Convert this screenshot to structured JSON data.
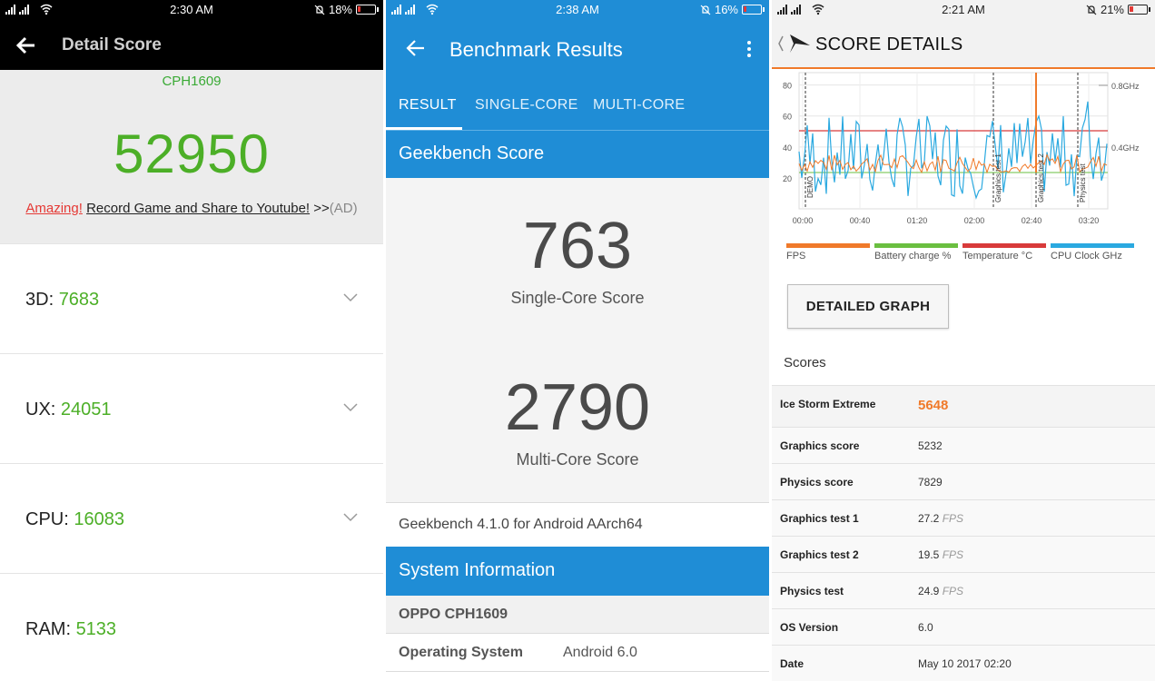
{
  "panel1": {
    "status": {
      "time": "2:30 AM",
      "battery": "18%",
      "battery_level": 0.18
    },
    "title": "Detail Score",
    "model": "CPH1609",
    "total_score": "52950",
    "promo": {
      "amazing": "Amazing!",
      "text": "Record Game and Share to Youtube!",
      "arrows": ">>",
      "ad": "(AD)"
    },
    "rows": [
      {
        "label": "3D:",
        "value": "7683"
      },
      {
        "label": "UX:",
        "value": "24051"
      },
      {
        "label": "CPU:",
        "value": "16083"
      },
      {
        "label": "RAM:",
        "value": "5133"
      }
    ]
  },
  "panel2": {
    "status": {
      "time": "2:38 AM",
      "battery": "16%",
      "battery_level": 0.16
    },
    "title": "Benchmark Results",
    "tabs": [
      "RESULT",
      "SINGLE-CORE",
      "MULTI-CORE"
    ],
    "score_header": "Geekbench Score",
    "single_core": {
      "value": "763",
      "label": "Single-Core Score"
    },
    "multi_core": {
      "value": "2790",
      "label": "Multi-Core Score"
    },
    "version": "Geekbench 4.1.0 for Android AArch64",
    "sys_header": "System Information",
    "device": "OPPO CPH1609",
    "os": {
      "label": "Operating System",
      "value": "Android 6.0"
    },
    "accent": "#1f8dd6"
  },
  "panel3": {
    "status": {
      "time": "2:21 AM",
      "battery": "21%",
      "battery_level": 0.21
    },
    "title": "SCORE DETAILS",
    "graph": {
      "y_ticks": [
        "80",
        "60",
        "40",
        "20"
      ],
      "x_ticks": [
        "00:00",
        "00:40",
        "01:20",
        "02:00",
        "02:40",
        "03:20"
      ],
      "right_ticks": [
        "0.8GHz",
        "0.4GHz"
      ],
      "markers": [
        "DEMO",
        "Graphics test 1",
        "Graphics test 2",
        "Physics test"
      ]
    },
    "legend": [
      {
        "label": "FPS",
        "color": "#f07a2a"
      },
      {
        "label": "Battery charge %",
        "color": "#6abf40"
      },
      {
        "label": "Temperature °C",
        "color": "#d83a3a"
      },
      {
        "label": "CPU Clock GHz",
        "color": "#2aa9e0"
      }
    ],
    "button": "DETAILED GRAPH",
    "scores_heading": "Scores",
    "scores": [
      {
        "label": "Ice Storm Extreme",
        "value": "5648",
        "unit": ""
      },
      {
        "label": "Graphics score",
        "value": "5232",
        "unit": ""
      },
      {
        "label": "Physics score",
        "value": "7829",
        "unit": ""
      },
      {
        "label": "Graphics test 1",
        "value": "27.2",
        "unit": "FPS"
      },
      {
        "label": "Graphics test 2",
        "value": "19.5",
        "unit": "FPS"
      },
      {
        "label": "Physics test",
        "value": "24.9",
        "unit": "FPS"
      },
      {
        "label": "OS Version",
        "value": "6.0",
        "unit": ""
      },
      {
        "label": "Date",
        "value": "May 10 2017 02:20",
        "unit": ""
      }
    ]
  }
}
